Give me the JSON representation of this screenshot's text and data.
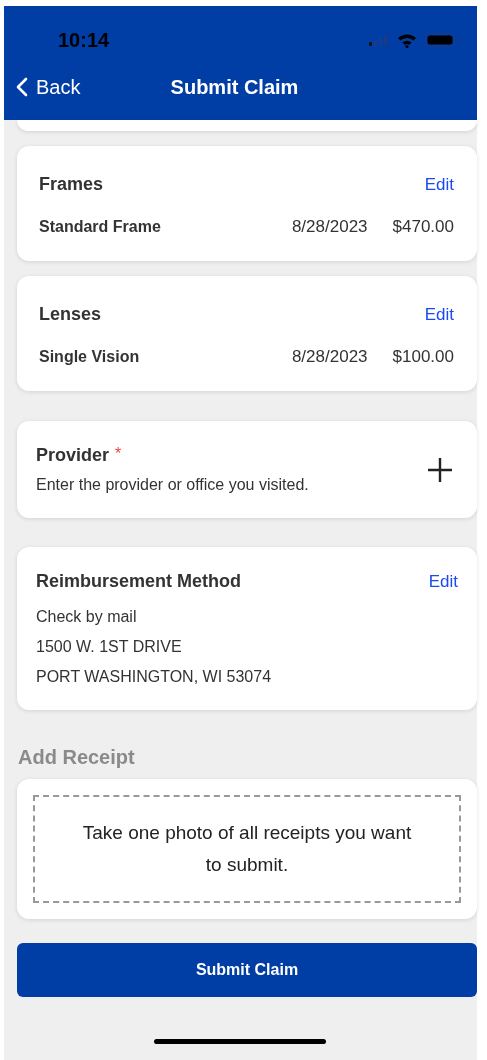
{
  "status_bar": {
    "time": "10:14"
  },
  "nav": {
    "back": "Back",
    "title": "Submit Claim"
  },
  "items": [
    {
      "title": "Frames",
      "action": "Edit",
      "name": "Standard Frame",
      "date": "8/28/2023",
      "amount": "$470.00"
    },
    {
      "title": "Lenses",
      "action": "Edit",
      "name": "Single Vision",
      "date": "8/28/2023",
      "amount": "$100.00"
    }
  ],
  "provider": {
    "title": "Provider",
    "required_mark": "*",
    "hint": "Enter the provider or office you visited."
  },
  "reimbursement": {
    "title": "Reimbursement Method",
    "action": "Edit",
    "lines": [
      "Check by mail",
      "1500 W. 1ST DRIVE",
      "PORT WASHINGTON, WI 53074"
    ]
  },
  "receipt": {
    "heading": "Add Receipt",
    "prompt": "Take one photo of all receipts you want to submit."
  },
  "submit": "Submit Claim"
}
